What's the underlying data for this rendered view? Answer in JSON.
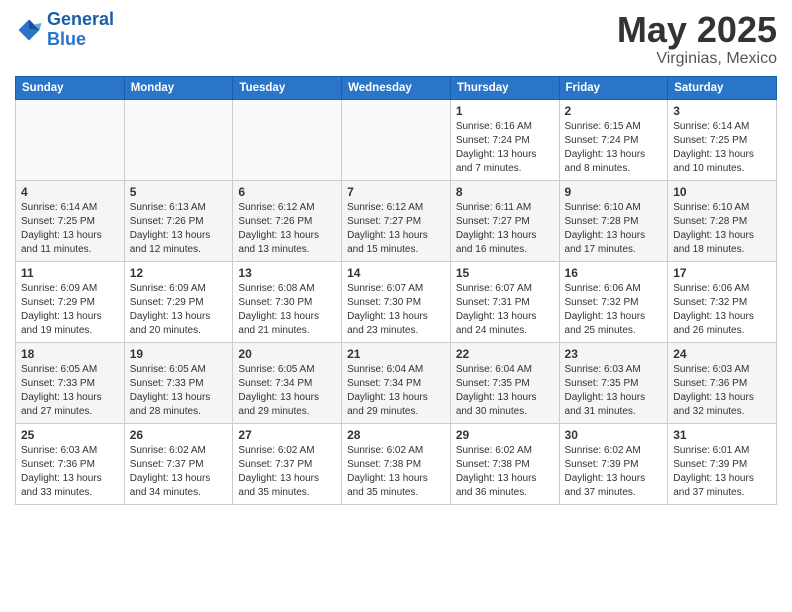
{
  "header": {
    "logo_line1": "General",
    "logo_line2": "Blue",
    "main_title": "May 2025",
    "subtitle": "Virginias, Mexico"
  },
  "days_of_week": [
    "Sunday",
    "Monday",
    "Tuesday",
    "Wednesday",
    "Thursday",
    "Friday",
    "Saturday"
  ],
  "weeks": [
    [
      {
        "day": "",
        "info": ""
      },
      {
        "day": "",
        "info": ""
      },
      {
        "day": "",
        "info": ""
      },
      {
        "day": "",
        "info": ""
      },
      {
        "day": "1",
        "info": "Sunrise: 6:16 AM\nSunset: 7:24 PM\nDaylight: 13 hours and 7 minutes."
      },
      {
        "day": "2",
        "info": "Sunrise: 6:15 AM\nSunset: 7:24 PM\nDaylight: 13 hours and 8 minutes."
      },
      {
        "day": "3",
        "info": "Sunrise: 6:14 AM\nSunset: 7:25 PM\nDaylight: 13 hours and 10 minutes."
      }
    ],
    [
      {
        "day": "4",
        "info": "Sunrise: 6:14 AM\nSunset: 7:25 PM\nDaylight: 13 hours and 11 minutes."
      },
      {
        "day": "5",
        "info": "Sunrise: 6:13 AM\nSunset: 7:26 PM\nDaylight: 13 hours and 12 minutes."
      },
      {
        "day": "6",
        "info": "Sunrise: 6:12 AM\nSunset: 7:26 PM\nDaylight: 13 hours and 13 minutes."
      },
      {
        "day": "7",
        "info": "Sunrise: 6:12 AM\nSunset: 7:27 PM\nDaylight: 13 hours and 15 minutes."
      },
      {
        "day": "8",
        "info": "Sunrise: 6:11 AM\nSunset: 7:27 PM\nDaylight: 13 hours and 16 minutes."
      },
      {
        "day": "9",
        "info": "Sunrise: 6:10 AM\nSunset: 7:28 PM\nDaylight: 13 hours and 17 minutes."
      },
      {
        "day": "10",
        "info": "Sunrise: 6:10 AM\nSunset: 7:28 PM\nDaylight: 13 hours and 18 minutes."
      }
    ],
    [
      {
        "day": "11",
        "info": "Sunrise: 6:09 AM\nSunset: 7:29 PM\nDaylight: 13 hours and 19 minutes."
      },
      {
        "day": "12",
        "info": "Sunrise: 6:09 AM\nSunset: 7:29 PM\nDaylight: 13 hours and 20 minutes."
      },
      {
        "day": "13",
        "info": "Sunrise: 6:08 AM\nSunset: 7:30 PM\nDaylight: 13 hours and 21 minutes."
      },
      {
        "day": "14",
        "info": "Sunrise: 6:07 AM\nSunset: 7:30 PM\nDaylight: 13 hours and 23 minutes."
      },
      {
        "day": "15",
        "info": "Sunrise: 6:07 AM\nSunset: 7:31 PM\nDaylight: 13 hours and 24 minutes."
      },
      {
        "day": "16",
        "info": "Sunrise: 6:06 AM\nSunset: 7:32 PM\nDaylight: 13 hours and 25 minutes."
      },
      {
        "day": "17",
        "info": "Sunrise: 6:06 AM\nSunset: 7:32 PM\nDaylight: 13 hours and 26 minutes."
      }
    ],
    [
      {
        "day": "18",
        "info": "Sunrise: 6:05 AM\nSunset: 7:33 PM\nDaylight: 13 hours and 27 minutes."
      },
      {
        "day": "19",
        "info": "Sunrise: 6:05 AM\nSunset: 7:33 PM\nDaylight: 13 hours and 28 minutes."
      },
      {
        "day": "20",
        "info": "Sunrise: 6:05 AM\nSunset: 7:34 PM\nDaylight: 13 hours and 29 minutes."
      },
      {
        "day": "21",
        "info": "Sunrise: 6:04 AM\nSunset: 7:34 PM\nDaylight: 13 hours and 29 minutes."
      },
      {
        "day": "22",
        "info": "Sunrise: 6:04 AM\nSunset: 7:35 PM\nDaylight: 13 hours and 30 minutes."
      },
      {
        "day": "23",
        "info": "Sunrise: 6:03 AM\nSunset: 7:35 PM\nDaylight: 13 hours and 31 minutes."
      },
      {
        "day": "24",
        "info": "Sunrise: 6:03 AM\nSunset: 7:36 PM\nDaylight: 13 hours and 32 minutes."
      }
    ],
    [
      {
        "day": "25",
        "info": "Sunrise: 6:03 AM\nSunset: 7:36 PM\nDaylight: 13 hours and 33 minutes."
      },
      {
        "day": "26",
        "info": "Sunrise: 6:02 AM\nSunset: 7:37 PM\nDaylight: 13 hours and 34 minutes."
      },
      {
        "day": "27",
        "info": "Sunrise: 6:02 AM\nSunset: 7:37 PM\nDaylight: 13 hours and 35 minutes."
      },
      {
        "day": "28",
        "info": "Sunrise: 6:02 AM\nSunset: 7:38 PM\nDaylight: 13 hours and 35 minutes."
      },
      {
        "day": "29",
        "info": "Sunrise: 6:02 AM\nSunset: 7:38 PM\nDaylight: 13 hours and 36 minutes."
      },
      {
        "day": "30",
        "info": "Sunrise: 6:02 AM\nSunset: 7:39 PM\nDaylight: 13 hours and 37 minutes."
      },
      {
        "day": "31",
        "info": "Sunrise: 6:01 AM\nSunset: 7:39 PM\nDaylight: 13 hours and 37 minutes."
      }
    ]
  ]
}
